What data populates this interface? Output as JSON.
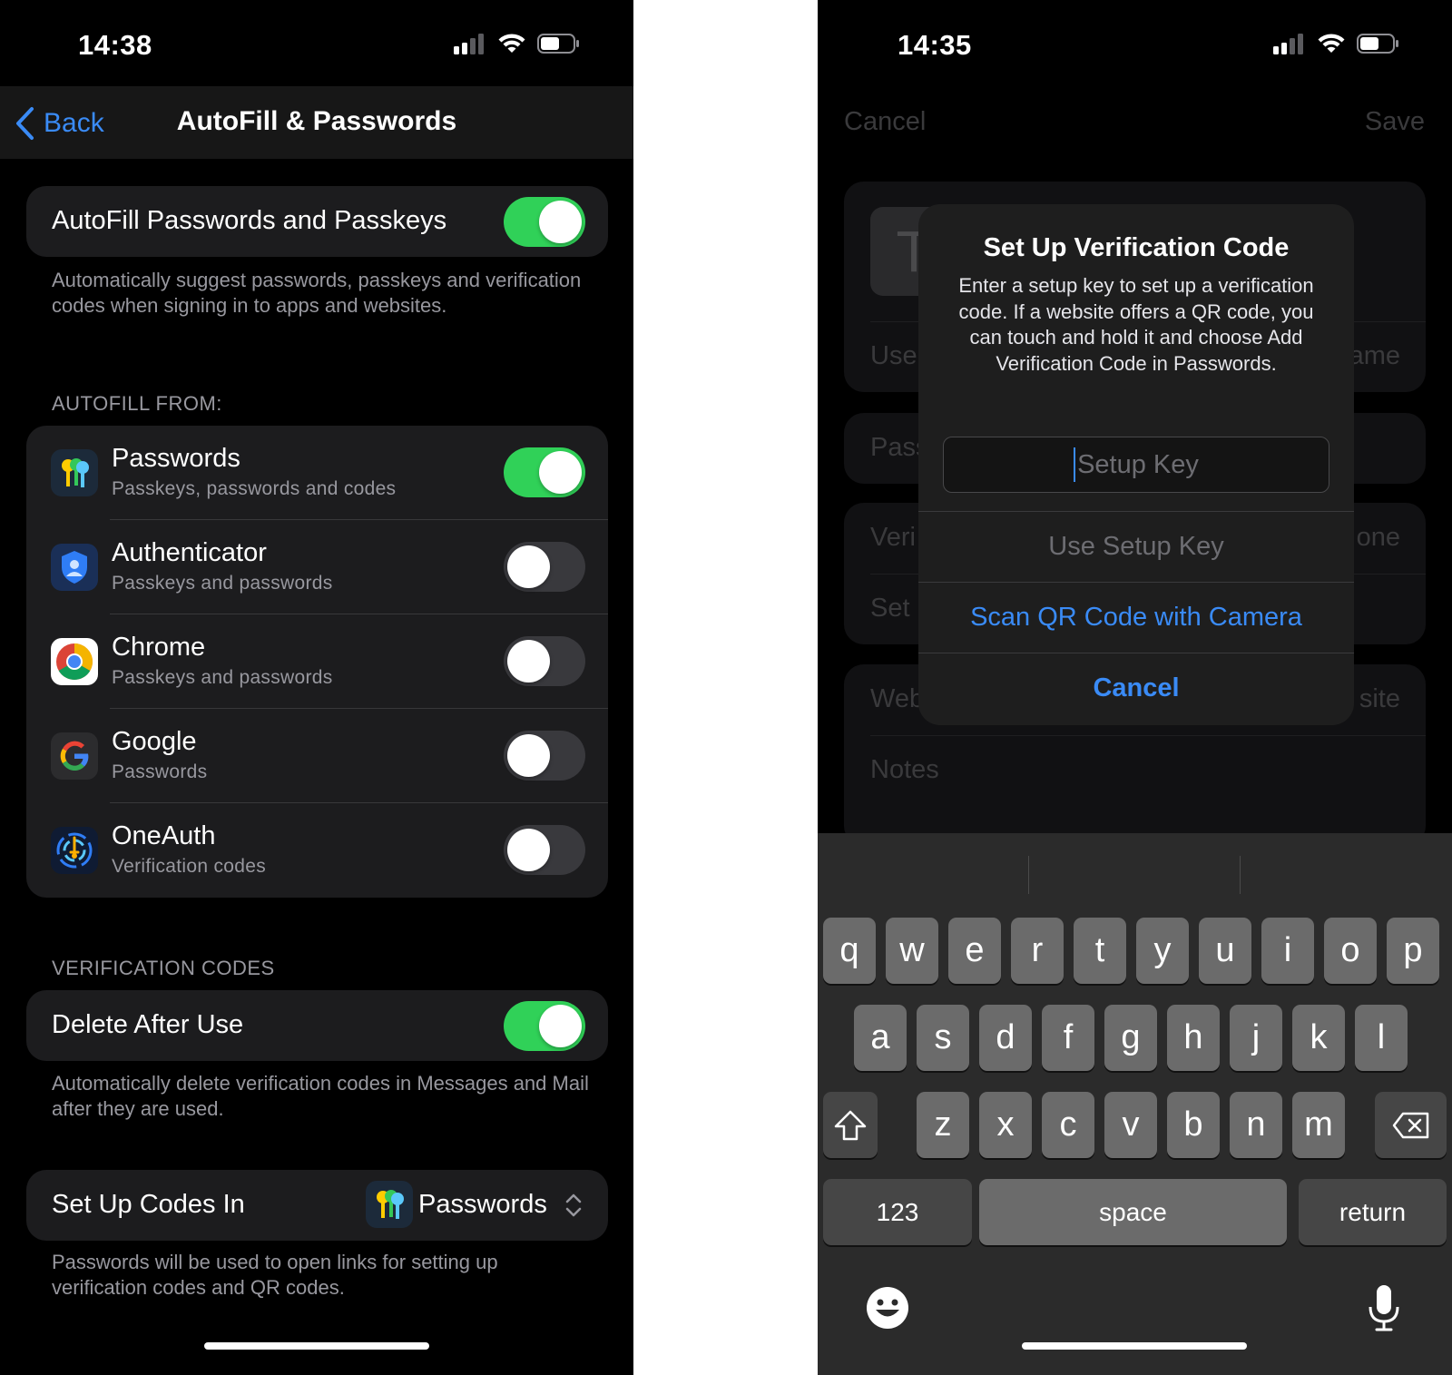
{
  "left": {
    "status": {
      "time": "14:38"
    },
    "nav": {
      "back_label": "Back",
      "title": "AutoFill & Passwords"
    },
    "autofill": {
      "label": "AutoFill Passwords and Passkeys",
      "enabled": true,
      "footnote": "Automatically suggest passwords, passkeys and verification codes when signing in to apps and websites."
    },
    "autofill_from": {
      "header": "AUTOFILL FROM:",
      "items": [
        {
          "name": "Passwords",
          "subtitle": "Passkeys, passwords and codes",
          "enabled": true,
          "icon": "passwords-app-icon"
        },
        {
          "name": "Authenticator",
          "subtitle": "Passkeys and passwords",
          "enabled": false,
          "icon": "authenticator-app-icon"
        },
        {
          "name": "Chrome",
          "subtitle": "Passkeys and passwords",
          "enabled": false,
          "icon": "chrome-app-icon"
        },
        {
          "name": "Google",
          "subtitle": "Passwords",
          "enabled": false,
          "icon": "google-app-icon"
        },
        {
          "name": "OneAuth",
          "subtitle": "Verification codes",
          "enabled": false,
          "icon": "oneauth-app-icon"
        }
      ]
    },
    "verification_codes": {
      "header": "VERIFICATION CODES",
      "delete_after_use": {
        "label": "Delete After Use",
        "enabled": true
      },
      "delete_footnote": "Automatically delete verification codes in Messages and Mail after they are used.",
      "setup_in": {
        "label": "Set Up Codes In",
        "value": "Passwords"
      },
      "setup_footnote": "Passwords will be used to open links for setting up verification codes and QR codes."
    }
  },
  "right": {
    "status": {
      "time": "14:35"
    },
    "nav": {
      "cancel_label": "Cancel",
      "save_label": "Save"
    },
    "background": {
      "tile_letter": "T",
      "user_fragment_left": "Use",
      "user_fragment_right": "ame",
      "pass_fragment": "Pass",
      "veri_fragment": "Veri",
      "veri_fragment_right": "one",
      "set_fragment": "Set",
      "web_fragment": "Web",
      "web_fragment_right": "site",
      "notes": "Notes"
    },
    "alert": {
      "title": "Set Up Verification Code",
      "message": "Enter a setup key to set up a verification code. If a website offers a QR code, you can touch and hold it and choose Add Verification Code in Passwords.",
      "input_placeholder": "Setup Key",
      "use_key_label": "Use Setup Key",
      "scan_label": "Scan QR Code with Camera",
      "cancel_label": "Cancel"
    },
    "keyboard": {
      "row1": [
        "q",
        "w",
        "e",
        "r",
        "t",
        "y",
        "u",
        "i",
        "o",
        "p"
      ],
      "row2": [
        "a",
        "s",
        "d",
        "f",
        "g",
        "h",
        "j",
        "k",
        "l"
      ],
      "row3": [
        "z",
        "x",
        "c",
        "v",
        "b",
        "n",
        "m"
      ],
      "numbers_label": "123",
      "space_label": "space",
      "return_label": "return"
    }
  }
}
